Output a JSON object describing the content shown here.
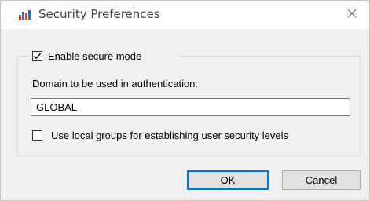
{
  "window": {
    "title": "Security Preferences",
    "app_icon": "bar-chart-app-icon",
    "close_icon": "close-icon"
  },
  "form": {
    "enable_secure_mode": {
      "label": "Enable secure mode",
      "checked": true
    },
    "domain": {
      "label": "Domain to be used in authentication:",
      "value": "GLOBAL"
    },
    "use_local_groups": {
      "label": "Use local groups for establishing user security levels",
      "checked": false
    }
  },
  "buttons": {
    "ok_label": "OK",
    "cancel_label": "Cancel"
  },
  "colors": {
    "default_button_border": "#0078d7",
    "dialog_background": "#f0f0f0"
  }
}
